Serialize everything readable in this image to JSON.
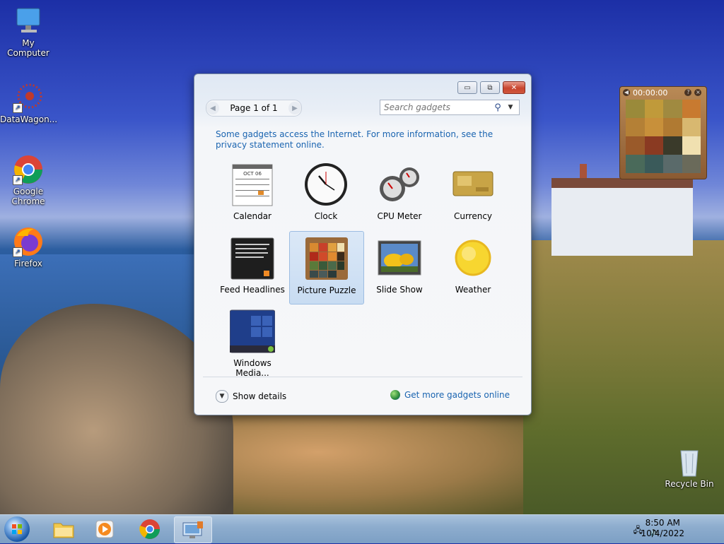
{
  "desktop": {
    "icons": [
      {
        "label": "My Computer",
        "icon": "computer-icon"
      },
      {
        "label": "DataWagon...",
        "icon": "datawagon-icon"
      },
      {
        "label": "Google\nChrome",
        "icon": "chrome-icon"
      },
      {
        "label": "Firefox",
        "icon": "firefox-icon"
      },
      {
        "label": "Recycle Bin",
        "icon": "recycle-bin-icon"
      }
    ]
  },
  "gadget_window": {
    "pager_label": "Page 1 of 1",
    "search_placeholder": "Search gadgets",
    "notice": "Some gadgets access the Internet.  For more information, see the privacy statement online.",
    "gadgets": [
      {
        "label": "Calendar",
        "icon": "calendar-icon"
      },
      {
        "label": "Clock",
        "icon": "clock-icon"
      },
      {
        "label": "CPU Meter",
        "icon": "cpu-meter-icon"
      },
      {
        "label": "Currency",
        "icon": "currency-icon"
      },
      {
        "label": "Feed Headlines",
        "icon": "feed-icon"
      },
      {
        "label": "Picture Puzzle",
        "icon": "picture-puzzle-icon",
        "selected": true
      },
      {
        "label": "Slide Show",
        "icon": "slide-show-icon"
      },
      {
        "label": "Weather",
        "icon": "weather-icon"
      },
      {
        "label": "Windows Media...",
        "icon": "windows-media-icon"
      }
    ],
    "show_details": "Show details",
    "get_more": "Get more gadgets online",
    "calendar_month": "OCT 06"
  },
  "puzzle_gadget": {
    "timer": "00:00:00"
  },
  "taskbar": {
    "time": "8:50 AM",
    "date": "10/4/2022"
  }
}
